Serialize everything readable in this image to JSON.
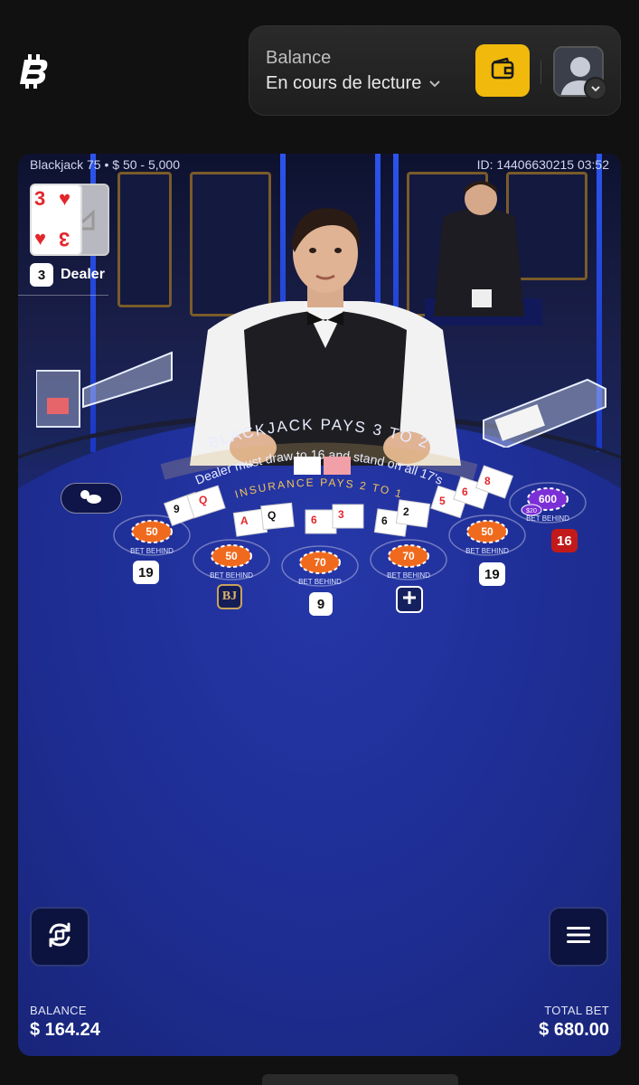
{
  "header": {
    "balance_label": "Balance",
    "balance_status": "En cours de lecture"
  },
  "game": {
    "table_name": "Blackjack 75 • $ 50 - 5,000",
    "round_id": "ID: 14406630215 03:52",
    "dealer": {
      "label": "Dealer",
      "score": "3",
      "card_rank": "3",
      "card_suit": "♥"
    },
    "table_text": {
      "main": "BLACKJACK PAYS 3 TO 2",
      "rule": "Dealer must draw to 16 and stand on all 17's",
      "insurance": "INSURANCE PAYS 2 TO 1"
    },
    "seats": [
      {
        "score": "19",
        "chip": "50"
      },
      {
        "score": "BJ",
        "chip": "50"
      },
      {
        "score": "9",
        "chip": "70"
      },
      {
        "score": "+",
        "chip": "70"
      },
      {
        "score": "19",
        "chip": "50"
      },
      {
        "score": "16",
        "chip": "600"
      }
    ],
    "side_chip": "$20",
    "bet_behind": "BET BEHIND"
  },
  "footer": {
    "balance_label": "BALANCE",
    "balance_value": "$ 164.24",
    "total_bet_label": "TOTAL BET",
    "total_bet_value": "$ 680.00"
  },
  "colors": {
    "accent": "#f0b90b",
    "felt": "#1f2f98",
    "chip_orange": "#f06a1e",
    "chip_purple": "#7b2fd6",
    "score_red": "#c21a1a"
  }
}
